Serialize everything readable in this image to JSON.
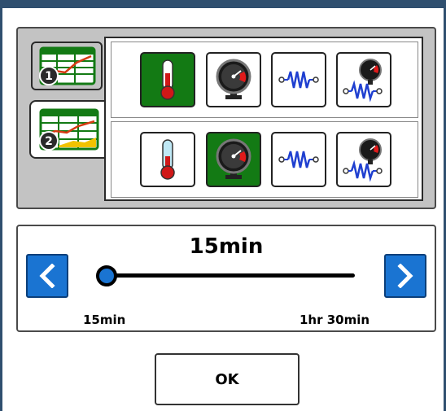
{
  "charts": [
    {
      "number": "1",
      "icon": "line-chart-icon",
      "selected": false
    },
    {
      "number": "2",
      "icon": "multi-series-chart-icon",
      "selected": true
    }
  ],
  "sensor_rows": [
    {
      "buttons": [
        {
          "icon": "thermometer-icon",
          "selected": true
        },
        {
          "icon": "pressure-gauge-icon",
          "selected": false
        },
        {
          "icon": "spring-icon",
          "selected": false
        },
        {
          "icon": "gauge-spring-icon",
          "selected": false
        }
      ]
    },
    {
      "buttons": [
        {
          "icon": "thermometer-icon",
          "selected": false
        },
        {
          "icon": "pressure-gauge-icon",
          "selected": true
        },
        {
          "icon": "spring-icon",
          "selected": false
        },
        {
          "icon": "gauge-spring-icon",
          "selected": false
        }
      ]
    }
  ],
  "slider": {
    "value_label": "15min",
    "min_label": "15min",
    "max_label": "1hr 30min",
    "position_fraction": 0
  },
  "ok_label": "OK",
  "colors": {
    "selected_bg": "#137a14",
    "accent_blue": "#1a74d2",
    "panel_gray": "#c3c3c3",
    "frame": "#2f4f6f"
  }
}
